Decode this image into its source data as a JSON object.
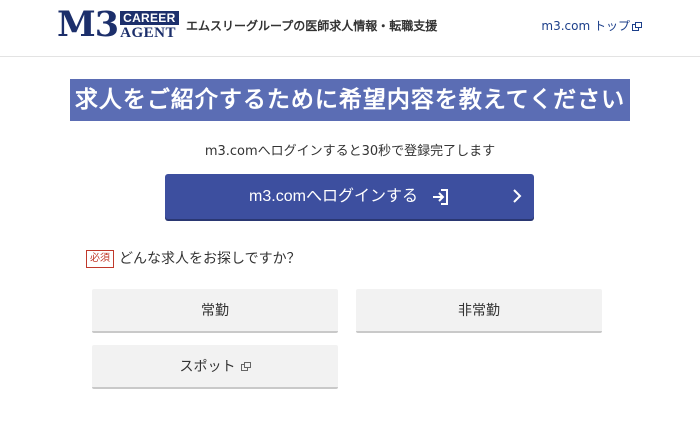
{
  "header": {
    "logo": {
      "m3": "M3",
      "career": "CAREER",
      "agent": "AGENT"
    },
    "tagline": "エムスリーグループの医師求人情報・転職支援",
    "top_link": "m3.com トップ",
    "top_link_icon": "external-link-icon"
  },
  "banner": {
    "title": "求人をご紹介するために希望内容を教えてください"
  },
  "login": {
    "note": "m3.comへログインすると30秒で登録完了します",
    "button_label": "m3.comへログインする",
    "button_icon": "login-icon"
  },
  "question": {
    "required_label": "必須",
    "text": "どんな求人をお探しですか？"
  },
  "choices": {
    "fulltime": "常勤",
    "parttime": "非常勤",
    "spot": "スポット"
  },
  "colors": {
    "brand_navy": "#1c2f6b",
    "banner": "#5b6db4",
    "button": "#3d4f9f",
    "required": "#c0392b",
    "choice_bg": "#f2f2f2"
  }
}
